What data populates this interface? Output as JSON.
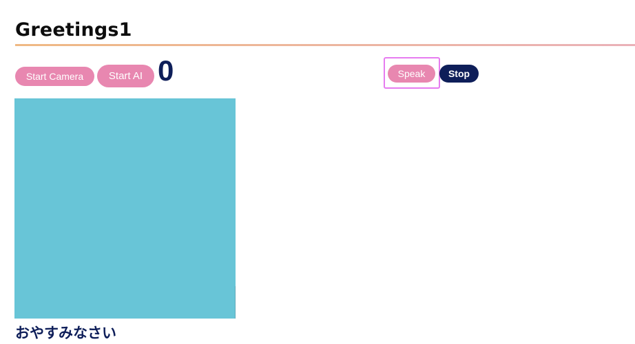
{
  "page": {
    "title": "Greetings1"
  },
  "controls": {
    "start_camera_label": "Start Camera",
    "start_ai_label": "Start AI",
    "counter_value": "0",
    "speak_label": "Speak",
    "stop_label": "Stop"
  },
  "camera": {
    "background_color": "#68c5d7"
  },
  "result": {
    "text": "おやすみなさい"
  },
  "colors": {
    "accent_pink": "#e887b0",
    "navy": "#0e1e59",
    "highlight": "#e67bf0",
    "rule_start": "#efb983",
    "rule_end": "#eab1b8"
  }
}
